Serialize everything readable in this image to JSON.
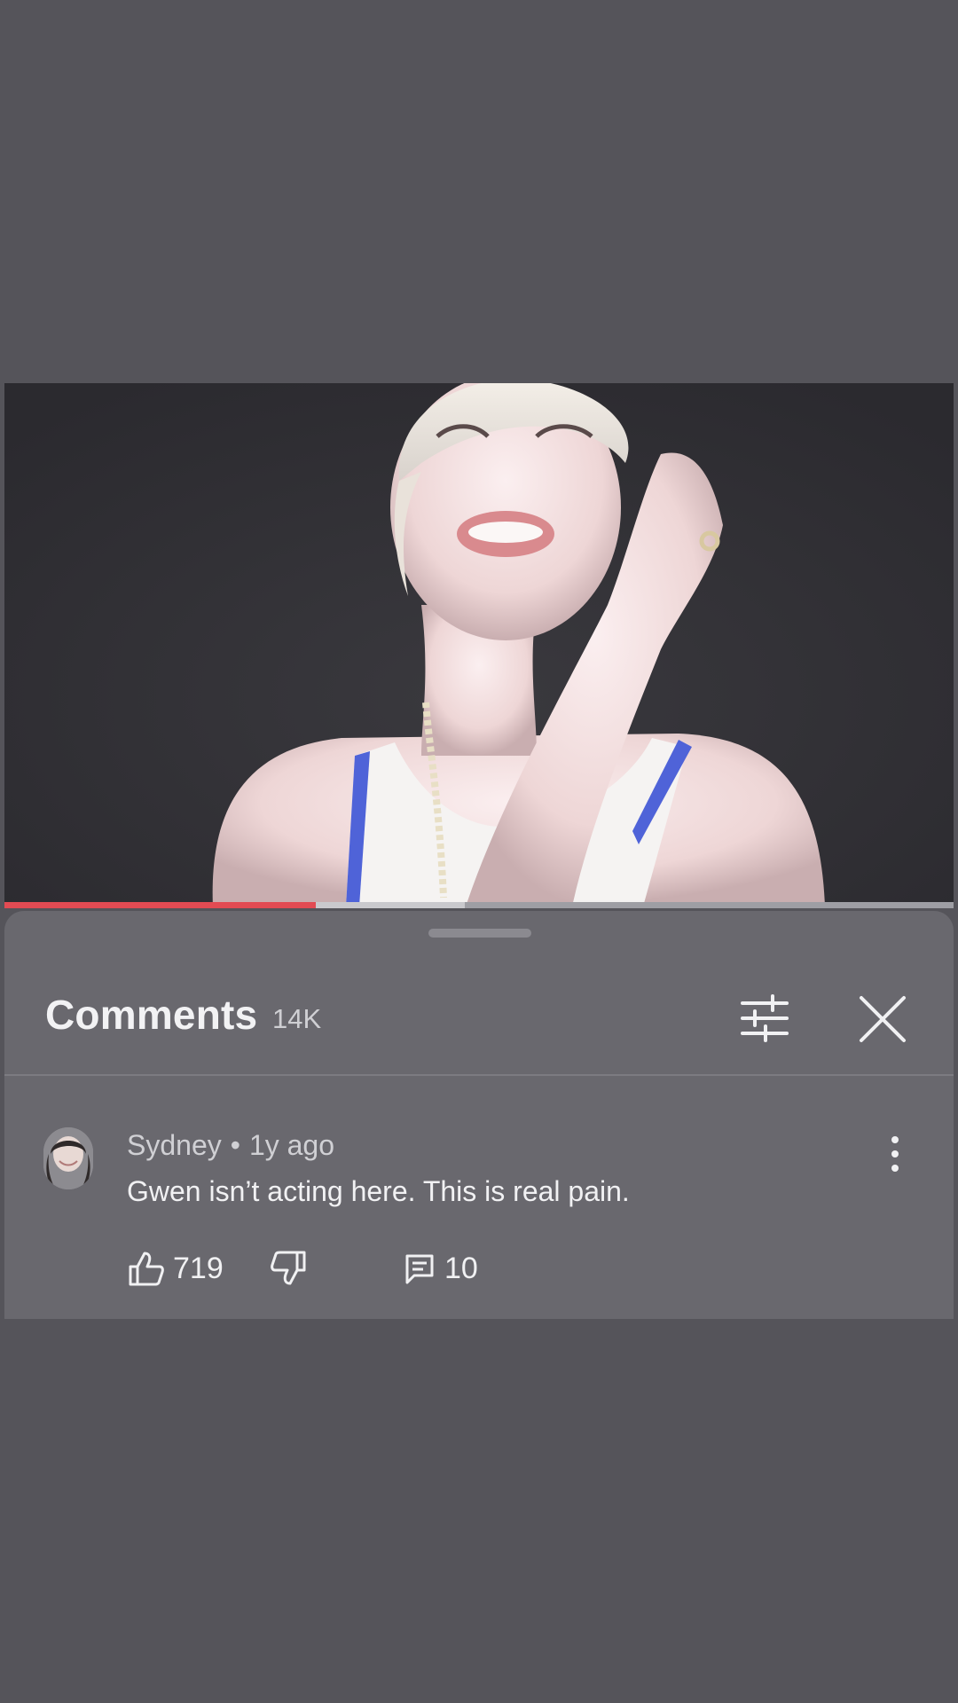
{
  "video": {
    "progress_percent": 32.8,
    "buffered_percent": 48.5
  },
  "comments_panel": {
    "title": "Comments",
    "count": "14K",
    "filter_icon": "sliders-icon",
    "close_icon": "close-icon"
  },
  "comments": [
    {
      "author": "Sydney",
      "separator": "•",
      "time": "1y ago",
      "text": "Gwen isn’t acting here. This is real pain.",
      "likes": "719",
      "replies": "10",
      "more_icon": "more-vert-icon"
    }
  ],
  "colors": {
    "background": "#55545a",
    "sheet": "#69686e",
    "progress": "#e24b53"
  }
}
